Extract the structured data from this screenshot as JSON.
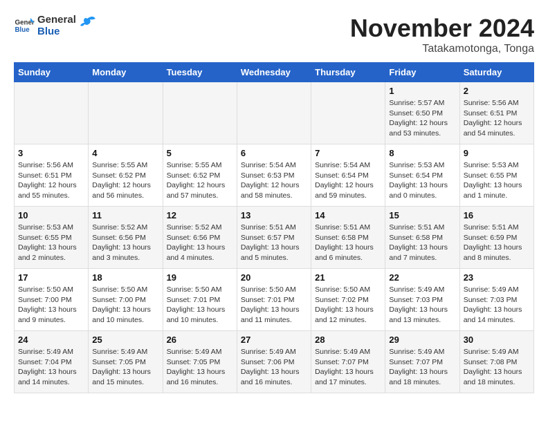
{
  "header": {
    "logo": {
      "general": "General",
      "blue": "Blue"
    },
    "title": "November 2024",
    "location": "Tatakamotonga, Tonga"
  },
  "weekdays": [
    "Sunday",
    "Monday",
    "Tuesday",
    "Wednesday",
    "Thursday",
    "Friday",
    "Saturday"
  ],
  "weeks": [
    [
      {
        "day": "",
        "info": ""
      },
      {
        "day": "",
        "info": ""
      },
      {
        "day": "",
        "info": ""
      },
      {
        "day": "",
        "info": ""
      },
      {
        "day": "",
        "info": ""
      },
      {
        "day": "1",
        "info": "Sunrise: 5:57 AM\nSunset: 6:50 PM\nDaylight: 12 hours\nand 53 minutes."
      },
      {
        "day": "2",
        "info": "Sunrise: 5:56 AM\nSunset: 6:51 PM\nDaylight: 12 hours\nand 54 minutes."
      }
    ],
    [
      {
        "day": "3",
        "info": "Sunrise: 5:56 AM\nSunset: 6:51 PM\nDaylight: 12 hours\nand 55 minutes."
      },
      {
        "day": "4",
        "info": "Sunrise: 5:55 AM\nSunset: 6:52 PM\nDaylight: 12 hours\nand 56 minutes."
      },
      {
        "day": "5",
        "info": "Sunrise: 5:55 AM\nSunset: 6:52 PM\nDaylight: 12 hours\nand 57 minutes."
      },
      {
        "day": "6",
        "info": "Sunrise: 5:54 AM\nSunset: 6:53 PM\nDaylight: 12 hours\nand 58 minutes."
      },
      {
        "day": "7",
        "info": "Sunrise: 5:54 AM\nSunset: 6:54 PM\nDaylight: 12 hours\nand 59 minutes."
      },
      {
        "day": "8",
        "info": "Sunrise: 5:53 AM\nSunset: 6:54 PM\nDaylight: 13 hours\nand 0 minutes."
      },
      {
        "day": "9",
        "info": "Sunrise: 5:53 AM\nSunset: 6:55 PM\nDaylight: 13 hours\nand 1 minute."
      }
    ],
    [
      {
        "day": "10",
        "info": "Sunrise: 5:53 AM\nSunset: 6:55 PM\nDaylight: 13 hours\nand 2 minutes."
      },
      {
        "day": "11",
        "info": "Sunrise: 5:52 AM\nSunset: 6:56 PM\nDaylight: 13 hours\nand 3 minutes."
      },
      {
        "day": "12",
        "info": "Sunrise: 5:52 AM\nSunset: 6:56 PM\nDaylight: 13 hours\nand 4 minutes."
      },
      {
        "day": "13",
        "info": "Sunrise: 5:51 AM\nSunset: 6:57 PM\nDaylight: 13 hours\nand 5 minutes."
      },
      {
        "day": "14",
        "info": "Sunrise: 5:51 AM\nSunset: 6:58 PM\nDaylight: 13 hours\nand 6 minutes."
      },
      {
        "day": "15",
        "info": "Sunrise: 5:51 AM\nSunset: 6:58 PM\nDaylight: 13 hours\nand 7 minutes."
      },
      {
        "day": "16",
        "info": "Sunrise: 5:51 AM\nSunset: 6:59 PM\nDaylight: 13 hours\nand 8 minutes."
      }
    ],
    [
      {
        "day": "17",
        "info": "Sunrise: 5:50 AM\nSunset: 7:00 PM\nDaylight: 13 hours\nand 9 minutes."
      },
      {
        "day": "18",
        "info": "Sunrise: 5:50 AM\nSunset: 7:00 PM\nDaylight: 13 hours\nand 10 minutes."
      },
      {
        "day": "19",
        "info": "Sunrise: 5:50 AM\nSunset: 7:01 PM\nDaylight: 13 hours\nand 10 minutes."
      },
      {
        "day": "20",
        "info": "Sunrise: 5:50 AM\nSunset: 7:01 PM\nDaylight: 13 hours\nand 11 minutes."
      },
      {
        "day": "21",
        "info": "Sunrise: 5:50 AM\nSunset: 7:02 PM\nDaylight: 13 hours\nand 12 minutes."
      },
      {
        "day": "22",
        "info": "Sunrise: 5:49 AM\nSunset: 7:03 PM\nDaylight: 13 hours\nand 13 minutes."
      },
      {
        "day": "23",
        "info": "Sunrise: 5:49 AM\nSunset: 7:03 PM\nDaylight: 13 hours\nand 14 minutes."
      }
    ],
    [
      {
        "day": "24",
        "info": "Sunrise: 5:49 AM\nSunset: 7:04 PM\nDaylight: 13 hours\nand 14 minutes."
      },
      {
        "day": "25",
        "info": "Sunrise: 5:49 AM\nSunset: 7:05 PM\nDaylight: 13 hours\nand 15 minutes."
      },
      {
        "day": "26",
        "info": "Sunrise: 5:49 AM\nSunset: 7:05 PM\nDaylight: 13 hours\nand 16 minutes."
      },
      {
        "day": "27",
        "info": "Sunrise: 5:49 AM\nSunset: 7:06 PM\nDaylight: 13 hours\nand 16 minutes."
      },
      {
        "day": "28",
        "info": "Sunrise: 5:49 AM\nSunset: 7:07 PM\nDaylight: 13 hours\nand 17 minutes."
      },
      {
        "day": "29",
        "info": "Sunrise: 5:49 AM\nSunset: 7:07 PM\nDaylight: 13 hours\nand 18 minutes."
      },
      {
        "day": "30",
        "info": "Sunrise: 5:49 AM\nSunset: 7:08 PM\nDaylight: 13 hours\nand 18 minutes."
      }
    ]
  ]
}
